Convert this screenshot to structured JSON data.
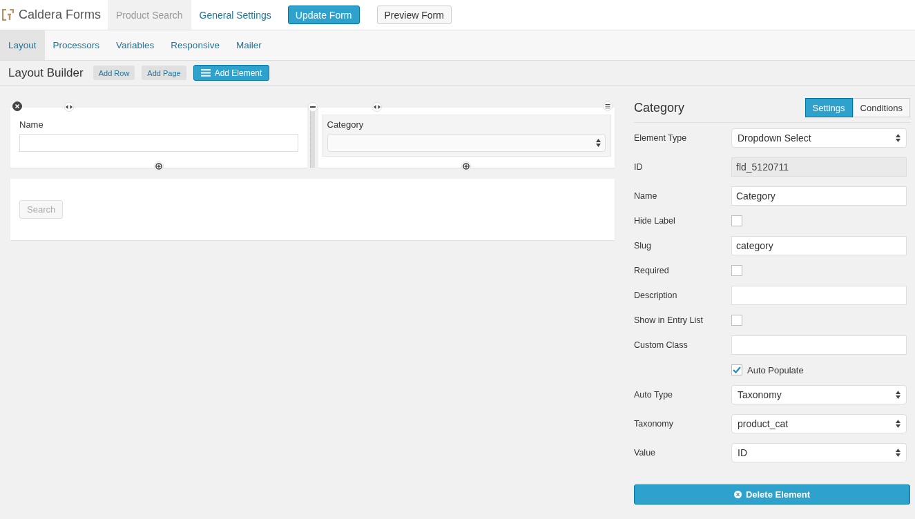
{
  "app": {
    "name": "Caldera Forms"
  },
  "nav": {
    "tabs": [
      {
        "label": "Product Search",
        "selected": true
      },
      {
        "label": "General Settings",
        "selected": false
      }
    ],
    "buttons": [
      {
        "label": "Update Form",
        "kind": "primary"
      },
      {
        "label": "Preview Form",
        "kind": "default"
      }
    ]
  },
  "subtabs": [
    {
      "label": "Layout",
      "selected": true
    },
    {
      "label": "Processors",
      "selected": false
    },
    {
      "label": "Variables",
      "selected": false
    },
    {
      "label": "Responsive",
      "selected": false
    },
    {
      "label": "Mailer",
      "selected": false
    }
  ],
  "toolbar": {
    "title": "Layout Builder",
    "buttons": [
      {
        "label": "Add Row",
        "kind": "small"
      },
      {
        "label": "Add Page",
        "kind": "small"
      },
      {
        "label": "Add Element",
        "kind": "primary"
      }
    ]
  },
  "canvas": {
    "rows": [
      {
        "columns": [
          {
            "fields": [
              {
                "kind": "text",
                "label": "Name",
                "selected": false
              }
            ]
          },
          {
            "fields": [
              {
                "kind": "select",
                "label": "Category",
                "selected": true
              }
            ]
          }
        ]
      },
      {
        "columns": [
          {
            "fields": [
              {
                "kind": "button",
                "label": "Search",
                "selected": false
              }
            ]
          }
        ]
      }
    ]
  },
  "settings": {
    "title": "Category",
    "tabs": [
      {
        "label": "Settings",
        "selected": true
      },
      {
        "label": "Conditions",
        "selected": false
      }
    ],
    "fields": [
      {
        "kind": "select",
        "label": "Element Type",
        "value": "Dropdown Select"
      },
      {
        "kind": "readonly",
        "label": "ID",
        "value": "fld_5120711"
      },
      {
        "kind": "text",
        "label": "Name",
        "value": "Category"
      },
      {
        "kind": "checkbox",
        "label": "Hide Label",
        "checked": false
      },
      {
        "kind": "text",
        "label": "Slug",
        "value": "category"
      },
      {
        "kind": "checkbox",
        "label": "Required",
        "checked": false
      },
      {
        "kind": "text",
        "label": "Description"
      },
      {
        "kind": "checkbox",
        "label": "Show in Entry List",
        "checked": false
      },
      {
        "kind": "text",
        "label": "Custom Class"
      },
      {
        "kind": "inline_checkbox",
        "label": "Auto Populate",
        "checked": true
      },
      {
        "kind": "select",
        "label": "Auto Type",
        "value": "Taxonomy"
      },
      {
        "kind": "select",
        "label": "Taxonomy",
        "value": "product_cat"
      },
      {
        "kind": "select",
        "label": "Value",
        "value": "ID"
      }
    ],
    "delete_button": "Delete Element"
  }
}
